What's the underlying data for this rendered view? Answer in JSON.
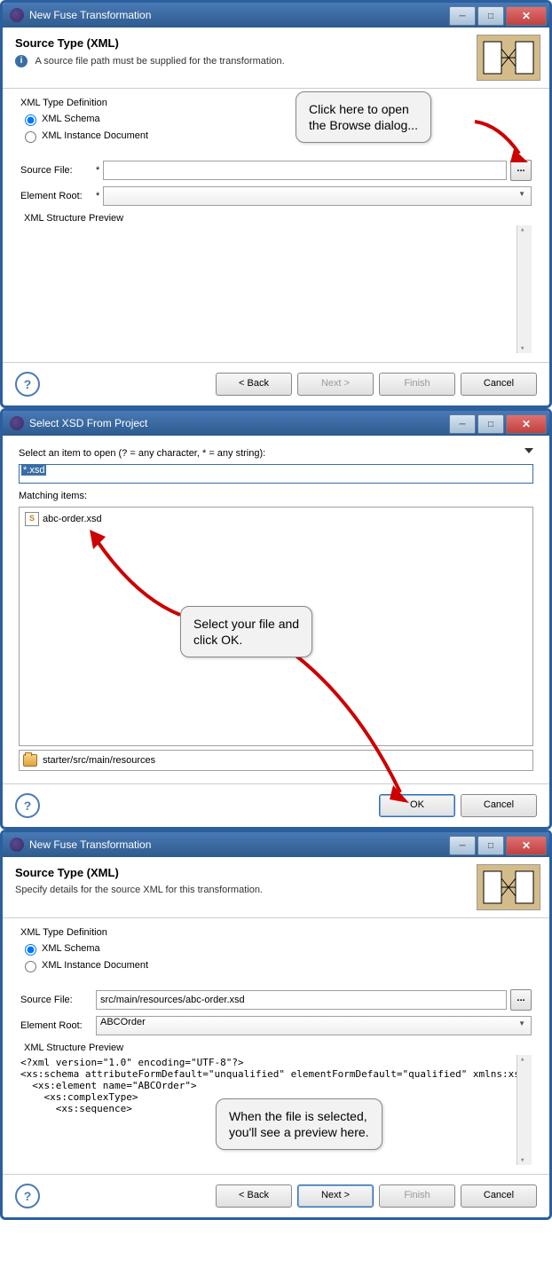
{
  "dialog1": {
    "title": "New Fuse Transformation",
    "header_title": "Source Type (XML)",
    "header_text": "A source file path must be supplied for the transformation.",
    "group_label": "XML Type Definition",
    "radio1": "XML Schema",
    "radio2": "XML Instance Document",
    "source_file_label": "Source File:",
    "source_file_value": "",
    "element_root_label": "Element Root:",
    "element_root_value": "",
    "preview_label": "XML Structure Preview",
    "back": "< Back",
    "next": "Next >",
    "finish": "Finish",
    "cancel": "Cancel"
  },
  "callout1": "Click here to open\nthe Browse dialog...",
  "dialog2": {
    "title": "Select XSD From Project",
    "prompt": "Select an item to open (? = any character, * = any string):",
    "input": "*.xsd",
    "matching_label": "Matching items:",
    "item": "abc-order.xsd",
    "path": "starter/src/main/resources",
    "ok": "OK",
    "cancel": "Cancel"
  },
  "callout2": "Select your file and\nclick OK.",
  "dialog3": {
    "title": "New Fuse Transformation",
    "header_title": "Source Type (XML)",
    "header_text": "Specify details for the source XML for this transformation.",
    "group_label": "XML Type Definition",
    "radio1": "XML Schema",
    "radio2": "XML Instance Document",
    "source_file_label": "Source File:",
    "source_file_value": "src/main/resources/abc-order.xsd",
    "element_root_label": "Element Root:",
    "element_root_value": "ABCOrder",
    "preview_label": "XML Structure Preview",
    "preview_content": "<?xml version=\"1.0\" encoding=\"UTF-8\"?>\n<xs:schema attributeFormDefault=\"unqualified\" elementFormDefault=\"qualified\" xmlns:xs=\"http://ww\n  <xs:element name=\"ABCOrder\">\n    <xs:complexType>\n      <xs:sequence>",
    "back": "< Back",
    "next": "Next >",
    "finish": "Finish",
    "cancel": "Cancel"
  },
  "callout3": "When the file is selected,\nyou'll see a preview here."
}
